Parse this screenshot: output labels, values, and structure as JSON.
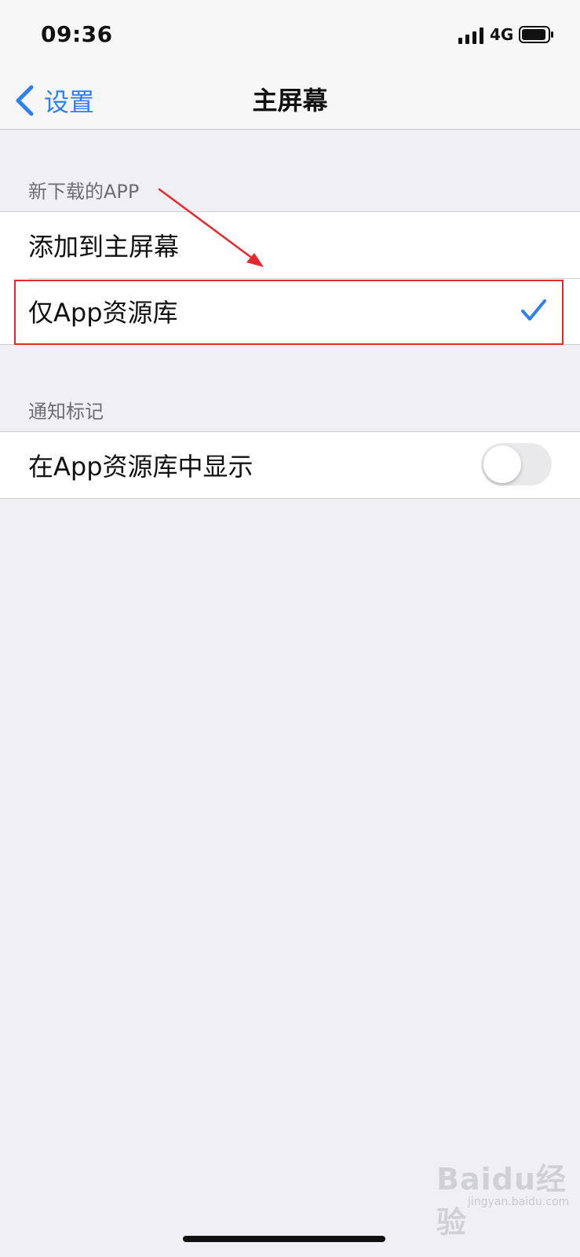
{
  "status_bar": {
    "time": "09:36",
    "network": "4G"
  },
  "nav": {
    "back_label": "设置",
    "title": "主屏幕"
  },
  "sections": [
    {
      "header": "新下载的APP",
      "options": [
        {
          "label": "添加到主屏幕",
          "selected": false
        },
        {
          "label": "仅App资源库",
          "selected": true
        }
      ]
    },
    {
      "header": "通知标记",
      "toggle": {
        "label": "在App资源库中显示",
        "on": false
      }
    }
  ],
  "colors": {
    "accent": "#2d7ff2",
    "highlight": "#e5292f"
  },
  "watermark": {
    "logo": "Baidu经验",
    "sub": "jingyan.baidu.com"
  }
}
